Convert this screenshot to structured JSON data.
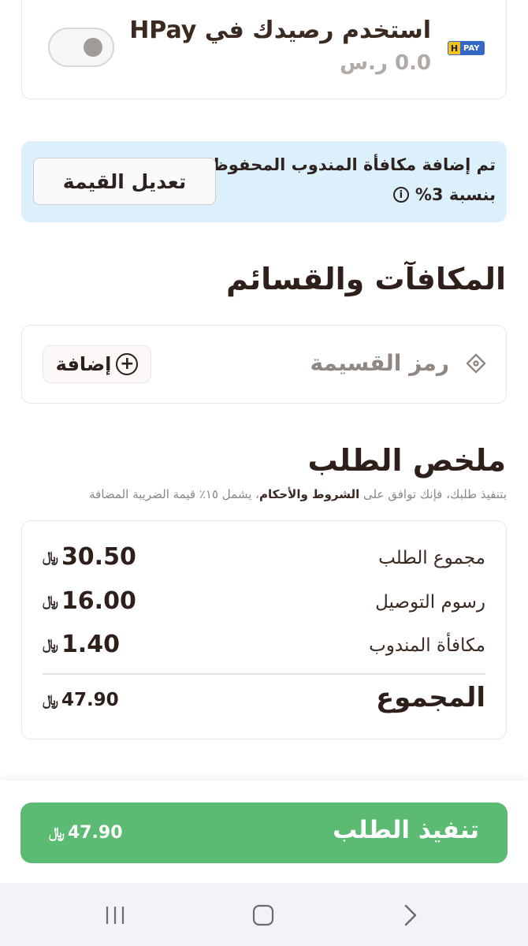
{
  "hpay": {
    "title": "استخدم رصيدك في HPay",
    "balance": "0.0 ر.س",
    "logo_h": "H",
    "logo_pay": "PAY",
    "toggle_on": false
  },
  "info_banner": {
    "line1": "تم إضافة مكافأة المندوب المحفوظة",
    "line2": "بنسبة 3%",
    "info_glyph": "i",
    "edit_button": "تعديل القيمة",
    "background": "#dcf0fb"
  },
  "rewards": {
    "heading": "المكافآت والقسائم",
    "coupon_label": "رمز القسيمة",
    "coupon_icon": "ticket-icon",
    "add_button": "إضافة"
  },
  "summary": {
    "heading": "ملخص الطلب",
    "terms_prefix": "بتنفيذ طلبك، فإنك توافق على ",
    "terms_link": "الشروط والأحكام",
    "terms_suffix": "، يشمل ١٥٪ قيمة الضريبة المضافة",
    "currency_symbol": "﷼",
    "rows": [
      {
        "label": "مجموع الطلب",
        "value": "30.50"
      },
      {
        "label": "رسوم التوصيل",
        "value": "16.00"
      },
      {
        "label": "مكافأة المندوب",
        "value": "1.40"
      }
    ],
    "total_label": "المجموع",
    "total_value": "47.90"
  },
  "checkout": {
    "label": "تنفيذ الطلب",
    "price": "47.90",
    "color": "#5bbb73"
  },
  "nav": {
    "recents_icon": "recents-icon",
    "home_icon": "home-icon",
    "back_icon": "back-icon"
  }
}
